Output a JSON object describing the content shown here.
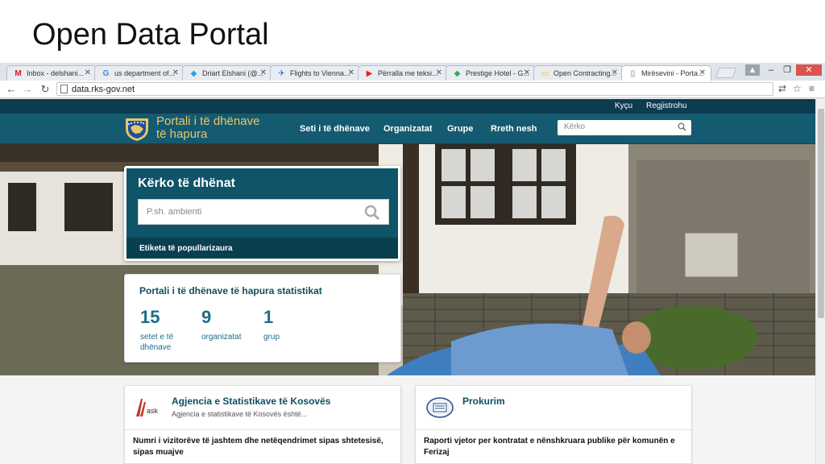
{
  "slide": {
    "title": "Open Data Portal"
  },
  "browser": {
    "tabs": [
      {
        "icon": "gmail-icon",
        "glyph": "M",
        "color": "#c5221f",
        "label": "Inbox - delshani..."
      },
      {
        "icon": "google-icon",
        "glyph": "G",
        "color": "#4285f4",
        "label": "us department of..."
      },
      {
        "icon": "twitter-icon",
        "glyph": "🐦",
        "color": "#1da1f2",
        "label": "Driart Elshani (@..."
      },
      {
        "icon": "flight-icon",
        "glyph": "✈",
        "color": "#1a73e8",
        "label": "Flights to Vienna..."
      },
      {
        "icon": "youtube-icon",
        "glyph": "▶",
        "color": "#e62117",
        "label": "Përralla me teksi..."
      },
      {
        "icon": "maps-icon",
        "glyph": "◆",
        "color": "#34a853",
        "label": "Prestige Hotel - G..."
      },
      {
        "icon": "folder-icon",
        "glyph": "▭",
        "color": "#f4b400",
        "label": "Open Contracting..."
      },
      {
        "icon": "page-icon",
        "glyph": "▯",
        "color": "#666666",
        "label": "Mirësevini - Porta..."
      }
    ],
    "url": "data.rks-gov.net"
  },
  "site": {
    "topbar": {
      "login": "Kyçu",
      "register": "Regjistrohu"
    },
    "logo": {
      "line1": "Portali i të dhënave",
      "line2": "të hapura"
    },
    "nav": [
      "Seti i të dhënave",
      "Organizatat",
      "Grupe",
      "Rreth nesh"
    ],
    "nav_search_placeholder": "Kërko",
    "search": {
      "title": "Kërko të dhënat",
      "placeholder": "P.sh. ambienti",
      "popular_tags": "Etiketa të popullarizaura"
    },
    "stats": {
      "title": "Portali i të dhënave të hapura statistikat",
      "items": [
        {
          "number": "15",
          "label": "setet e të dhënave"
        },
        {
          "number": "9",
          "label": "organizatat"
        },
        {
          "number": "1",
          "label": "grup"
        }
      ]
    },
    "cards": [
      {
        "logo": "ask-logo",
        "title": "Agjencia e Statistikave të Kosovës",
        "subtitle": "Agjencia e statistikave të Kosovës është...",
        "item": "Numri i vizitorëve të jashtem dhe netëqendrimet sipas shtetesisë, sipas muajve"
      },
      {
        "logo": "prokurim-logo",
        "title": "Prokurim",
        "subtitle": "",
        "item": "Raporti vjetor per kontratat e nënshkruara publike për komunën e Ferizaj"
      }
    ],
    "colors": {
      "navy": "#0d3b4f",
      "teal": "#145a70",
      "gold": "#e8c66a",
      "stat_blue": "#1b6e8a"
    }
  }
}
